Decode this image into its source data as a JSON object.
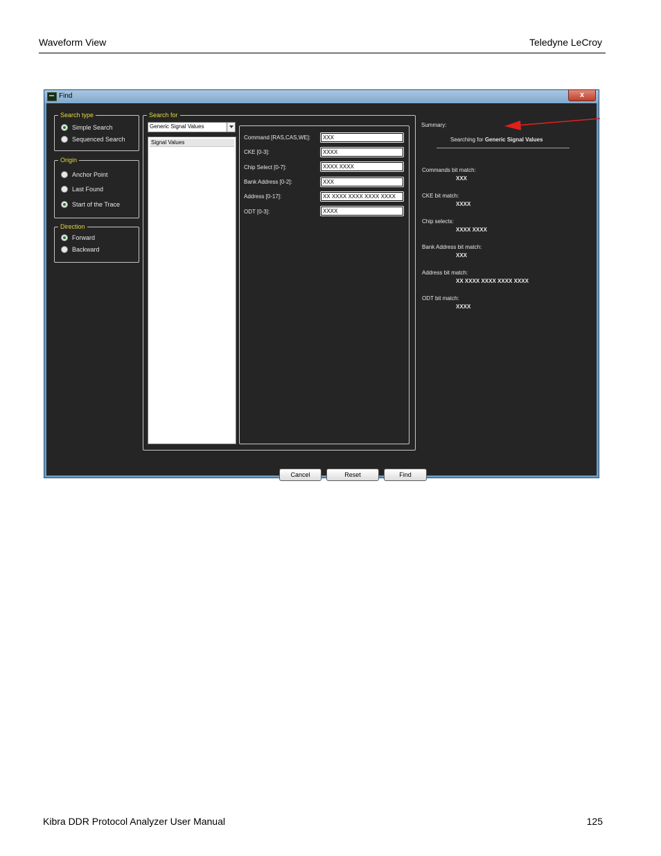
{
  "page": {
    "header_left": "Waveform View",
    "header_right": "Teledyne LeCroy",
    "footer_left": "Kibra DDR Protocol Analyzer User Manual",
    "footer_right": "125"
  },
  "window": {
    "title": "Find",
    "close_label": "x"
  },
  "search_type": {
    "title": "Search type",
    "options": [
      "Simple Search",
      "Sequenced Search"
    ],
    "selected": "Simple Search"
  },
  "origin": {
    "title": "Origin",
    "options": [
      "Anchor Point",
      "Last Found",
      "Start of the Trace"
    ],
    "selected": "Start of the Trace"
  },
  "direction": {
    "title": "Direction",
    "options": [
      "Forward",
      "Backward"
    ],
    "selected": "Forward"
  },
  "search_for": {
    "title": "Search for",
    "combo_value": "Generic Signal Values",
    "list_items": [
      "Signal Values"
    ]
  },
  "fields": [
    {
      "label": "Command [RAS,CAS,WE]:",
      "value": "XXX"
    },
    {
      "label": "CKE [0-3]:",
      "value": "XXXX"
    },
    {
      "label": "Chip Select [0-7]:",
      "value": "XXXX XXXX"
    },
    {
      "label": "Bank Address [0-2]:",
      "value": "XXX"
    },
    {
      "label": "Address [0-17]:",
      "value": "XX XXXX XXXX XXXX XXXX"
    },
    {
      "label": "ODT [0-3]:",
      "value": "XXXX"
    }
  ],
  "summary": {
    "label": "Summary:",
    "searching_prefix": "Searching for",
    "searching_target": "Generic Signal Values",
    "items": [
      {
        "label": "Commands bit match:",
        "value": "XXX"
      },
      {
        "label": "CKE bit match:",
        "value": "XXXX"
      },
      {
        "label": "Chip selects:",
        "value": "XXXX XXXX"
      },
      {
        "label": "Bank Address bit match:",
        "value": "XXX"
      },
      {
        "label": "Address bit match:",
        "value": "XX XXXX XXXX XXXX XXXX"
      },
      {
        "label": "ODT bit match:",
        "value": "XXXX"
      }
    ]
  },
  "buttons": {
    "cancel": "Cancel",
    "reset": "Reset",
    "find": "Find"
  },
  "colors": {
    "dialog_background": "#252525",
    "group_title": "#e6d93c",
    "annotation_arrow": "#e0201a"
  }
}
